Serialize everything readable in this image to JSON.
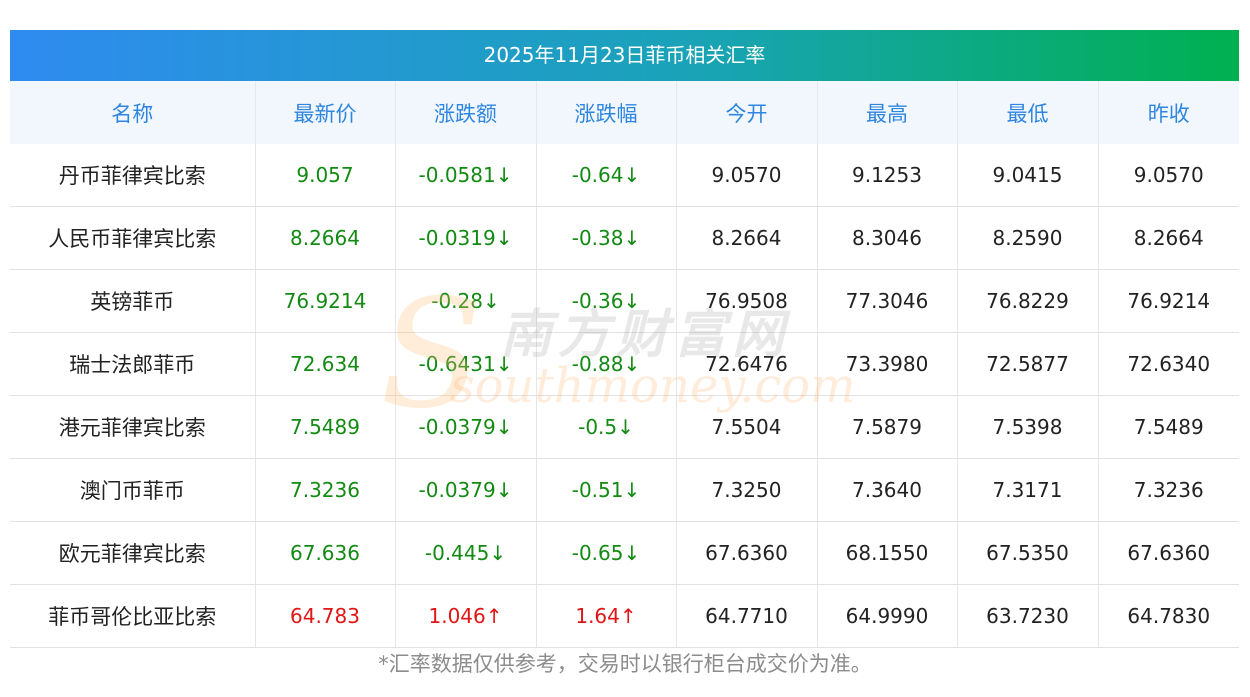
{
  "title": "2025年11月23日菲币相关汇率",
  "headers": [
    "名称",
    "最新价",
    "涨跌额",
    "涨跌幅",
    "今开",
    "最高",
    "最低",
    "昨收"
  ],
  "rows": [
    {
      "name": "丹币菲律宾比索",
      "latest": "9.057",
      "change": "-0.0581↓",
      "pct": "-0.64↓",
      "open": "9.0570",
      "high": "9.1253",
      "low": "9.0415",
      "prev": "9.0570",
      "dir": "down"
    },
    {
      "name": "人民币菲律宾比索",
      "latest": "8.2664",
      "change": "-0.0319↓",
      "pct": "-0.38↓",
      "open": "8.2664",
      "high": "8.3046",
      "low": "8.2590",
      "prev": "8.2664",
      "dir": "down"
    },
    {
      "name": "英镑菲币",
      "latest": "76.9214",
      "change": "-0.28↓",
      "pct": "-0.36↓",
      "open": "76.9508",
      "high": "77.3046",
      "low": "76.8229",
      "prev": "76.9214",
      "dir": "down"
    },
    {
      "name": "瑞士法郎菲币",
      "latest": "72.634",
      "change": "-0.6431↓",
      "pct": "-0.88↓",
      "open": "72.6476",
      "high": "73.3980",
      "low": "72.5877",
      "prev": "72.6340",
      "dir": "down"
    },
    {
      "name": "港元菲律宾比索",
      "latest": "7.5489",
      "change": "-0.0379↓",
      "pct": "-0.5↓",
      "open": "7.5504",
      "high": "7.5879",
      "low": "7.5398",
      "prev": "7.5489",
      "dir": "down"
    },
    {
      "name": "澳门币菲币",
      "latest": "7.3236",
      "change": "-0.0379↓",
      "pct": "-0.51↓",
      "open": "7.3250",
      "high": "7.3640",
      "low": "7.3171",
      "prev": "7.3236",
      "dir": "down"
    },
    {
      "name": "欧元菲律宾比索",
      "latest": "67.636",
      "change": "-0.445↓",
      "pct": "-0.65↓",
      "open": "67.6360",
      "high": "68.1550",
      "low": "67.5350",
      "prev": "67.6360",
      "dir": "down"
    },
    {
      "name": "菲币哥伦比亚比索",
      "latest": "64.783",
      "change": "1.046↑",
      "pct": "1.64↑",
      "open": "64.7710",
      "high": "64.9990",
      "low": "63.7230",
      "prev": "64.7830",
      "dir": "up"
    }
  ],
  "footnote": "*汇率数据仅供参考，交易时以银行柜台成交价为准。",
  "watermark": {
    "cn": "南方财富网",
    "en": "southmoney.com"
  },
  "colors": {
    "down": "#138a13",
    "up": "#e01515",
    "header_text": "#2f86e0",
    "title_gradient_start": "#2f8bf0",
    "title_gradient_end": "#00b050"
  }
}
